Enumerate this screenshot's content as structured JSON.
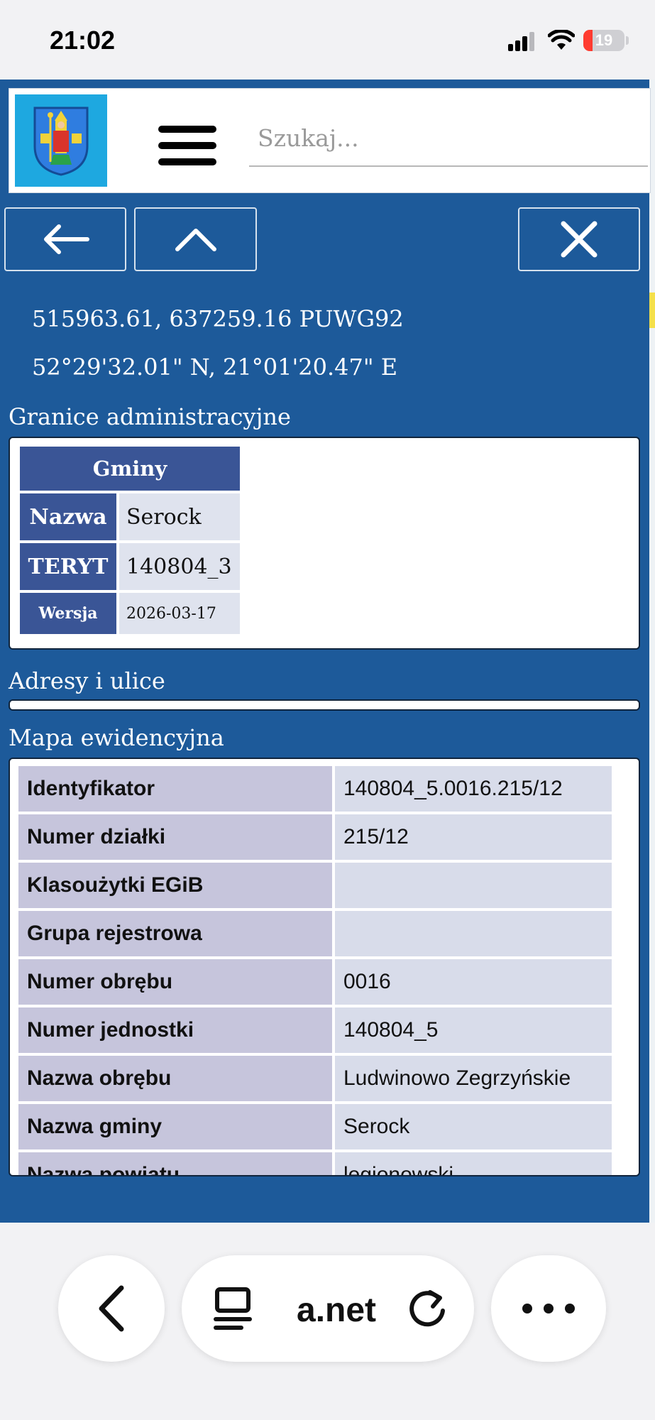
{
  "status_bar": {
    "time": "21:02",
    "battery": "19"
  },
  "search": {
    "placeholder": "Szukaj..."
  },
  "coords": {
    "puwg": "515963.61, 637259.16 PUWG92",
    "wgs": "52°29'32.01\" N, 21°01'20.47\" E"
  },
  "granice": {
    "title": "Granice administracyjne",
    "table_header": "Gminy",
    "rows": [
      {
        "key": "Nazwa",
        "value": "Serock"
      },
      {
        "key": "TERYT",
        "value": "140804_3"
      },
      {
        "key": "Wersja",
        "value": "2026-03-17"
      }
    ]
  },
  "adresy": {
    "title": "Adresy i ulice"
  },
  "mapa": {
    "title": "Mapa ewidencyjna",
    "rows": [
      {
        "key": "Identyfikator",
        "value": "140804_5.0016.215/12"
      },
      {
        "key": "Numer działki",
        "value": "215/12"
      },
      {
        "key": "Klasoużytki EGiB",
        "value": ""
      },
      {
        "key": "Grupa rejestrowa",
        "value": ""
      },
      {
        "key": "Numer obrębu",
        "value": "0016"
      },
      {
        "key": "Numer jednostki",
        "value": "140804_5"
      },
      {
        "key": "Nazwa obrębu",
        "value": "Ludwinowo Zegrzyńskie"
      },
      {
        "key": "Nazwa gminy",
        "value": "Serock"
      },
      {
        "key": "Nazwa powiatu",
        "value": "legionowski"
      }
    ]
  },
  "browser": {
    "url": "a.net"
  },
  "colors": {
    "panel": "#1d5a9a",
    "header_cell": "#3a5596",
    "logo_bg": "#1ea8e0"
  }
}
